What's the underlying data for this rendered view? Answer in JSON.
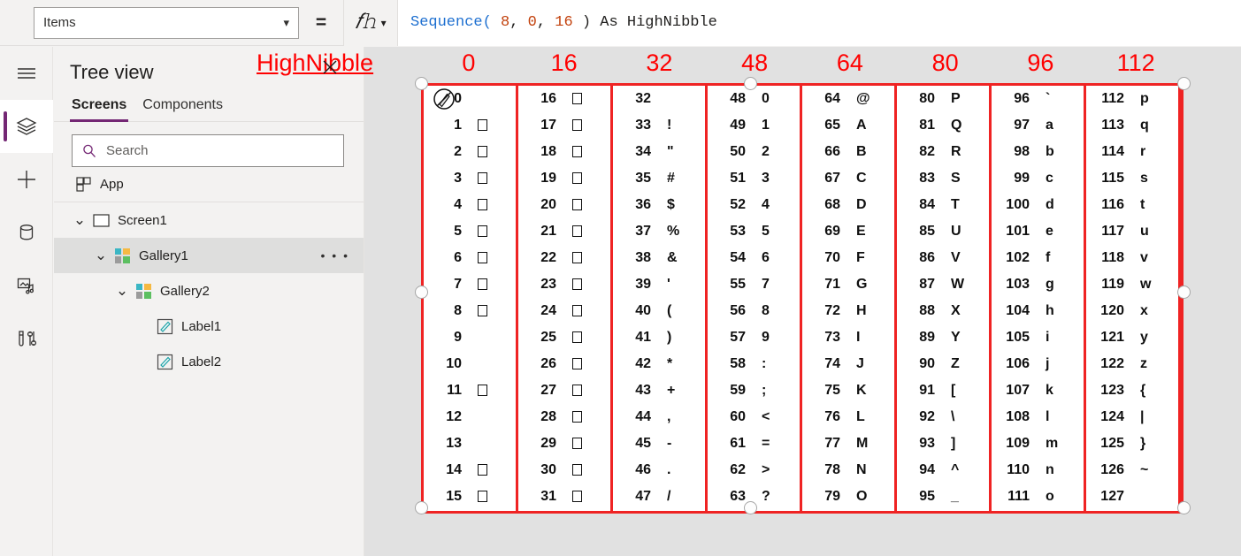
{
  "formula_bar": {
    "property_value": "Items",
    "property_chevron": "chevron-down-icon",
    "equals": "=",
    "fx_label": "fx",
    "fx_chevron": "chevron-down-icon",
    "formula_tokens": [
      {
        "t": "Sequence(",
        "k": "fn"
      },
      {
        "t": " 8",
        "k": "num"
      },
      {
        "t": ",",
        "k": "plain"
      },
      {
        "t": " 0",
        "k": "num"
      },
      {
        "t": ",",
        "k": "plain"
      },
      {
        "t": " 16",
        "k": "num"
      },
      {
        "t": " ) As HighNibble",
        "k": "plain"
      }
    ],
    "formula_text": "Sequence( 8, 0, 16 ) As HighNibble"
  },
  "rail": {
    "items": [
      {
        "name": "hamburger-menu-icon",
        "active": false
      },
      {
        "name": "tree-view-layers-icon",
        "active": true
      },
      {
        "name": "insert-plus-icon",
        "active": false
      },
      {
        "name": "data-database-icon",
        "active": false
      },
      {
        "name": "media-icon",
        "active": false
      },
      {
        "name": "variables-icon",
        "active": false
      }
    ]
  },
  "tree": {
    "title": "Tree view",
    "tabs": [
      {
        "label": "Screens",
        "active": true
      },
      {
        "label": "Components",
        "active": false
      }
    ],
    "search": {
      "placeholder": "Search",
      "value": "",
      "icon": "search-icon"
    },
    "app_item": {
      "label": "App",
      "icon": "app-grid-icon"
    },
    "nodes": [
      {
        "label": "Screen1",
        "indent": 0,
        "icon": "screen-icon",
        "expanded": true,
        "selected": false,
        "menu": false
      },
      {
        "label": "Gallery1",
        "indent": 1,
        "icon": "gallery-icon",
        "expanded": true,
        "selected": true,
        "menu": true
      },
      {
        "label": "Gallery2",
        "indent": 2,
        "icon": "gallery-icon",
        "expanded": true,
        "selected": false,
        "menu": false
      },
      {
        "label": "Label1",
        "indent": 3,
        "icon": "label-icon",
        "expanded": false,
        "selected": false,
        "menu": false
      },
      {
        "label": "Label2",
        "indent": 3,
        "icon": "label-icon",
        "expanded": false,
        "selected": false,
        "menu": false
      }
    ]
  },
  "canvas": {
    "annotation_label": "HighNibble",
    "annotation_color": "#ff0000",
    "selection_color": "#ef2323",
    "column_headers": [
      "0",
      "16",
      "32",
      "48",
      "64",
      "80",
      "96",
      "112"
    ],
    "columns": [
      {
        "header": "0",
        "rows": [
          {
            "n": "0",
            "c": ""
          },
          {
            "n": "1",
            "c": "□"
          },
          {
            "n": "2",
            "c": "□"
          },
          {
            "n": "3",
            "c": "□"
          },
          {
            "n": "4",
            "c": "□"
          },
          {
            "n": "5",
            "c": "□"
          },
          {
            "n": "6",
            "c": "□"
          },
          {
            "n": "7",
            "c": "□"
          },
          {
            "n": "8",
            "c": "□"
          },
          {
            "n": "9",
            "c": ""
          },
          {
            "n": "10",
            "c": ""
          },
          {
            "n": "11",
            "c": "□"
          },
          {
            "n": "12",
            "c": ""
          },
          {
            "n": "13",
            "c": ""
          },
          {
            "n": "14",
            "c": "□"
          },
          {
            "n": "15",
            "c": "□"
          }
        ]
      },
      {
        "header": "16",
        "rows": [
          {
            "n": "16",
            "c": "□"
          },
          {
            "n": "17",
            "c": "□"
          },
          {
            "n": "18",
            "c": "□"
          },
          {
            "n": "19",
            "c": "□"
          },
          {
            "n": "20",
            "c": "□"
          },
          {
            "n": "21",
            "c": "□"
          },
          {
            "n": "22",
            "c": "□"
          },
          {
            "n": "23",
            "c": "□"
          },
          {
            "n": "24",
            "c": "□"
          },
          {
            "n": "25",
            "c": "□"
          },
          {
            "n": "26",
            "c": "□"
          },
          {
            "n": "27",
            "c": "□"
          },
          {
            "n": "28",
            "c": "□"
          },
          {
            "n": "29",
            "c": "□"
          },
          {
            "n": "30",
            "c": "□"
          },
          {
            "n": "31",
            "c": "□"
          }
        ]
      },
      {
        "header": "32",
        "rows": [
          {
            "n": "32",
            "c": ""
          },
          {
            "n": "33",
            "c": "!"
          },
          {
            "n": "34",
            "c": "\""
          },
          {
            "n": "35",
            "c": "#"
          },
          {
            "n": "36",
            "c": "$"
          },
          {
            "n": "37",
            "c": "%"
          },
          {
            "n": "38",
            "c": "&"
          },
          {
            "n": "39",
            "c": "'"
          },
          {
            "n": "40",
            "c": "("
          },
          {
            "n": "41",
            "c": ")"
          },
          {
            "n": "42",
            "c": "*"
          },
          {
            "n": "43",
            "c": "+"
          },
          {
            "n": "44",
            "c": ","
          },
          {
            "n": "45",
            "c": "-"
          },
          {
            "n": "46",
            "c": "."
          },
          {
            "n": "47",
            "c": "/"
          }
        ]
      },
      {
        "header": "48",
        "rows": [
          {
            "n": "48",
            "c": "0"
          },
          {
            "n": "49",
            "c": "1"
          },
          {
            "n": "50",
            "c": "2"
          },
          {
            "n": "51",
            "c": "3"
          },
          {
            "n": "52",
            "c": "4"
          },
          {
            "n": "53",
            "c": "5"
          },
          {
            "n": "54",
            "c": "6"
          },
          {
            "n": "55",
            "c": "7"
          },
          {
            "n": "56",
            "c": "8"
          },
          {
            "n": "57",
            "c": "9"
          },
          {
            "n": "58",
            "c": ":"
          },
          {
            "n": "59",
            "c": ";"
          },
          {
            "n": "60",
            "c": "<"
          },
          {
            "n": "61",
            "c": "="
          },
          {
            "n": "62",
            "c": ">"
          },
          {
            "n": "63",
            "c": "?"
          }
        ]
      },
      {
        "header": "64",
        "rows": [
          {
            "n": "64",
            "c": "@"
          },
          {
            "n": "65",
            "c": "A"
          },
          {
            "n": "66",
            "c": "B"
          },
          {
            "n": "67",
            "c": "C"
          },
          {
            "n": "68",
            "c": "D"
          },
          {
            "n": "69",
            "c": "E"
          },
          {
            "n": "70",
            "c": "F"
          },
          {
            "n": "71",
            "c": "G"
          },
          {
            "n": "72",
            "c": "H"
          },
          {
            "n": "73",
            "c": "I"
          },
          {
            "n": "74",
            "c": "J"
          },
          {
            "n": "75",
            "c": "K"
          },
          {
            "n": "76",
            "c": "L"
          },
          {
            "n": "77",
            "c": "M"
          },
          {
            "n": "78",
            "c": "N"
          },
          {
            "n": "79",
            "c": "O"
          }
        ]
      },
      {
        "header": "80",
        "rows": [
          {
            "n": "80",
            "c": "P"
          },
          {
            "n": "81",
            "c": "Q"
          },
          {
            "n": "82",
            "c": "R"
          },
          {
            "n": "83",
            "c": "S"
          },
          {
            "n": "84",
            "c": "T"
          },
          {
            "n": "85",
            "c": "U"
          },
          {
            "n": "86",
            "c": "V"
          },
          {
            "n": "87",
            "c": "W"
          },
          {
            "n": "88",
            "c": "X"
          },
          {
            "n": "89",
            "c": "Y"
          },
          {
            "n": "90",
            "c": "Z"
          },
          {
            "n": "91",
            "c": "["
          },
          {
            "n": "92",
            "c": "\\"
          },
          {
            "n": "93",
            "c": "]"
          },
          {
            "n": "94",
            "c": "^"
          },
          {
            "n": "95",
            "c": "_"
          }
        ]
      },
      {
        "header": "96",
        "rows": [
          {
            "n": "96",
            "c": "`"
          },
          {
            "n": "97",
            "c": "a"
          },
          {
            "n": "98",
            "c": "b"
          },
          {
            "n": "99",
            "c": "c"
          },
          {
            "n": "100",
            "c": "d"
          },
          {
            "n": "101",
            "c": "e"
          },
          {
            "n": "102",
            "c": "f"
          },
          {
            "n": "103",
            "c": "g"
          },
          {
            "n": "104",
            "c": "h"
          },
          {
            "n": "105",
            "c": "i"
          },
          {
            "n": "106",
            "c": "j"
          },
          {
            "n": "107",
            "c": "k"
          },
          {
            "n": "108",
            "c": "l"
          },
          {
            "n": "109",
            "c": "m"
          },
          {
            "n": "110",
            "c": "n"
          },
          {
            "n": "111",
            "c": "o"
          }
        ]
      },
      {
        "header": "112",
        "rows": [
          {
            "n": "112",
            "c": "p"
          },
          {
            "n": "113",
            "c": "q"
          },
          {
            "n": "114",
            "c": "r"
          },
          {
            "n": "115",
            "c": "s"
          },
          {
            "n": "116",
            "c": "t"
          },
          {
            "n": "117",
            "c": "u"
          },
          {
            "n": "118",
            "c": "v"
          },
          {
            "n": "119",
            "c": "w"
          },
          {
            "n": "120",
            "c": "x"
          },
          {
            "n": "121",
            "c": "y"
          },
          {
            "n": "122",
            "c": "z"
          },
          {
            "n": "123",
            "c": "{"
          },
          {
            "n": "124",
            "c": "|"
          },
          {
            "n": "125",
            "c": "}"
          },
          {
            "n": "126",
            "c": "~"
          },
          {
            "n": "127",
            "c": ""
          }
        ]
      }
    ]
  }
}
